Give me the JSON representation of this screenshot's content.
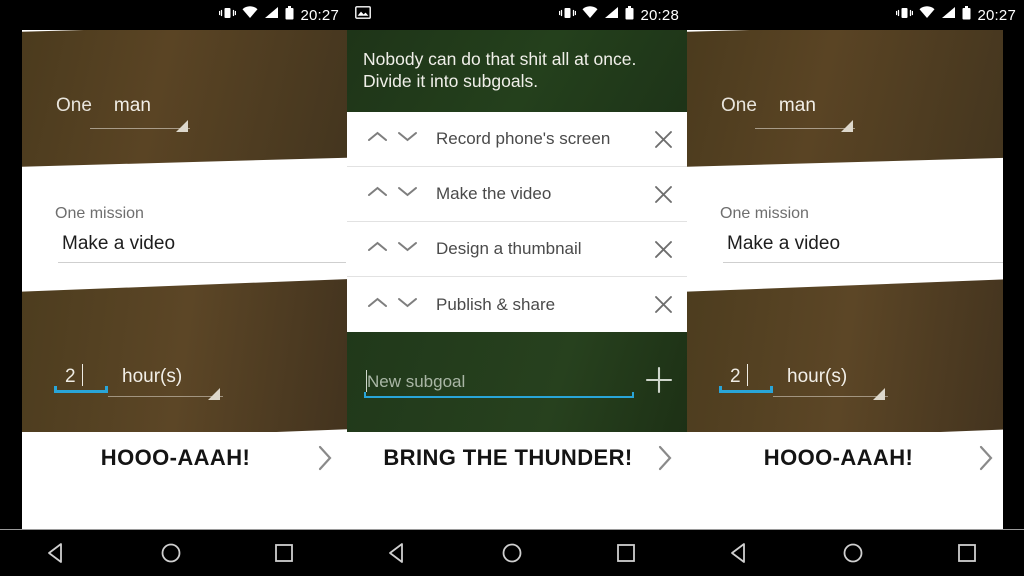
{
  "app": {
    "accent_cyan": "#29a5d8",
    "brown": "#4f3e20",
    "green": "#223c1b"
  },
  "panels": [
    {
      "id": "left",
      "statusbar": {
        "time": "20:27",
        "icons": [
          "vibrate-icon",
          "wifi-icon",
          "signal-icon",
          "battery-icon"
        ]
      },
      "form": {
        "one_label": "One",
        "man_value": "man",
        "mission_label": "One mission",
        "mission_value": "Make a video",
        "hours_value": "2",
        "hours_unit": "hour(s)"
      },
      "cta": {
        "label": "HOOO-AAAH!",
        "chevron": "chevron-right-icon"
      }
    },
    {
      "id": "middle",
      "statusbar": {
        "time": "20:28",
        "icons": [
          "screenshot-icon",
          "vibrate-icon",
          "wifi-icon",
          "signal-icon",
          "battery-icon"
        ]
      },
      "header": "Nobody can do that shit all at once.\nDivide it into subgoals.",
      "subgoals": [
        {
          "text": "Record phone's screen"
        },
        {
          "text": "Make the video"
        },
        {
          "text": "Design a thumbnail"
        },
        {
          "text": "Publish &  share"
        }
      ],
      "new_subgoal": {
        "placeholder": "New subgoal",
        "value": "",
        "add_label": "+"
      },
      "cta": {
        "label": "BRING THE THUNDER!",
        "chevron": "chevron-right-icon"
      }
    },
    {
      "id": "right",
      "statusbar": {
        "time": "20:27",
        "icons": [
          "vibrate-icon",
          "wifi-icon",
          "signal-icon",
          "battery-icon"
        ]
      },
      "form": {
        "one_label": "One",
        "man_value": "man",
        "mission_label": "One mission",
        "mission_value": "Make a video",
        "hours_value": "2",
        "hours_unit": "hour(s)"
      },
      "cta": {
        "label": "HOOO-AAAH!",
        "chevron": "chevron-right-icon"
      }
    }
  ],
  "navbar": {
    "back": "back-triangle-icon",
    "home": "home-circle-icon",
    "recents": "recents-square-icon"
  }
}
